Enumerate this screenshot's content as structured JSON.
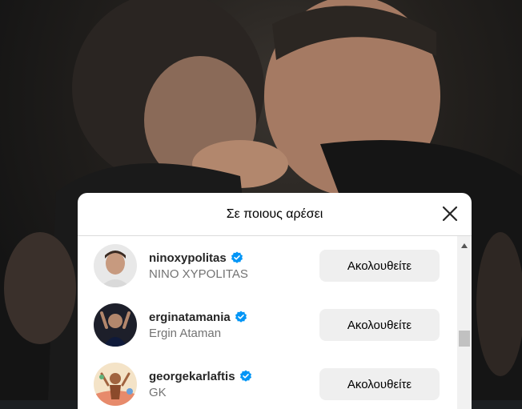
{
  "dialog": {
    "title": "Σε ποιους αρέσει",
    "close_icon": "close-icon"
  },
  "users": [
    {
      "username": "ninoxypolitas",
      "full_name": "NINO XYPOLITAS",
      "verified": true,
      "button_label": "Ακολουθείτε"
    },
    {
      "username": "erginatamania",
      "full_name": "Ergin Ataman",
      "verified": true,
      "button_label": "Ακολουθείτε"
    },
    {
      "username": "georgekarlaftis",
      "full_name": "GK",
      "verified": true,
      "button_label": "Ακολουθείτε"
    }
  ],
  "colors": {
    "verified_blue": "#0095f6",
    "button_bg": "#efefef",
    "secondary_text": "#737373"
  }
}
